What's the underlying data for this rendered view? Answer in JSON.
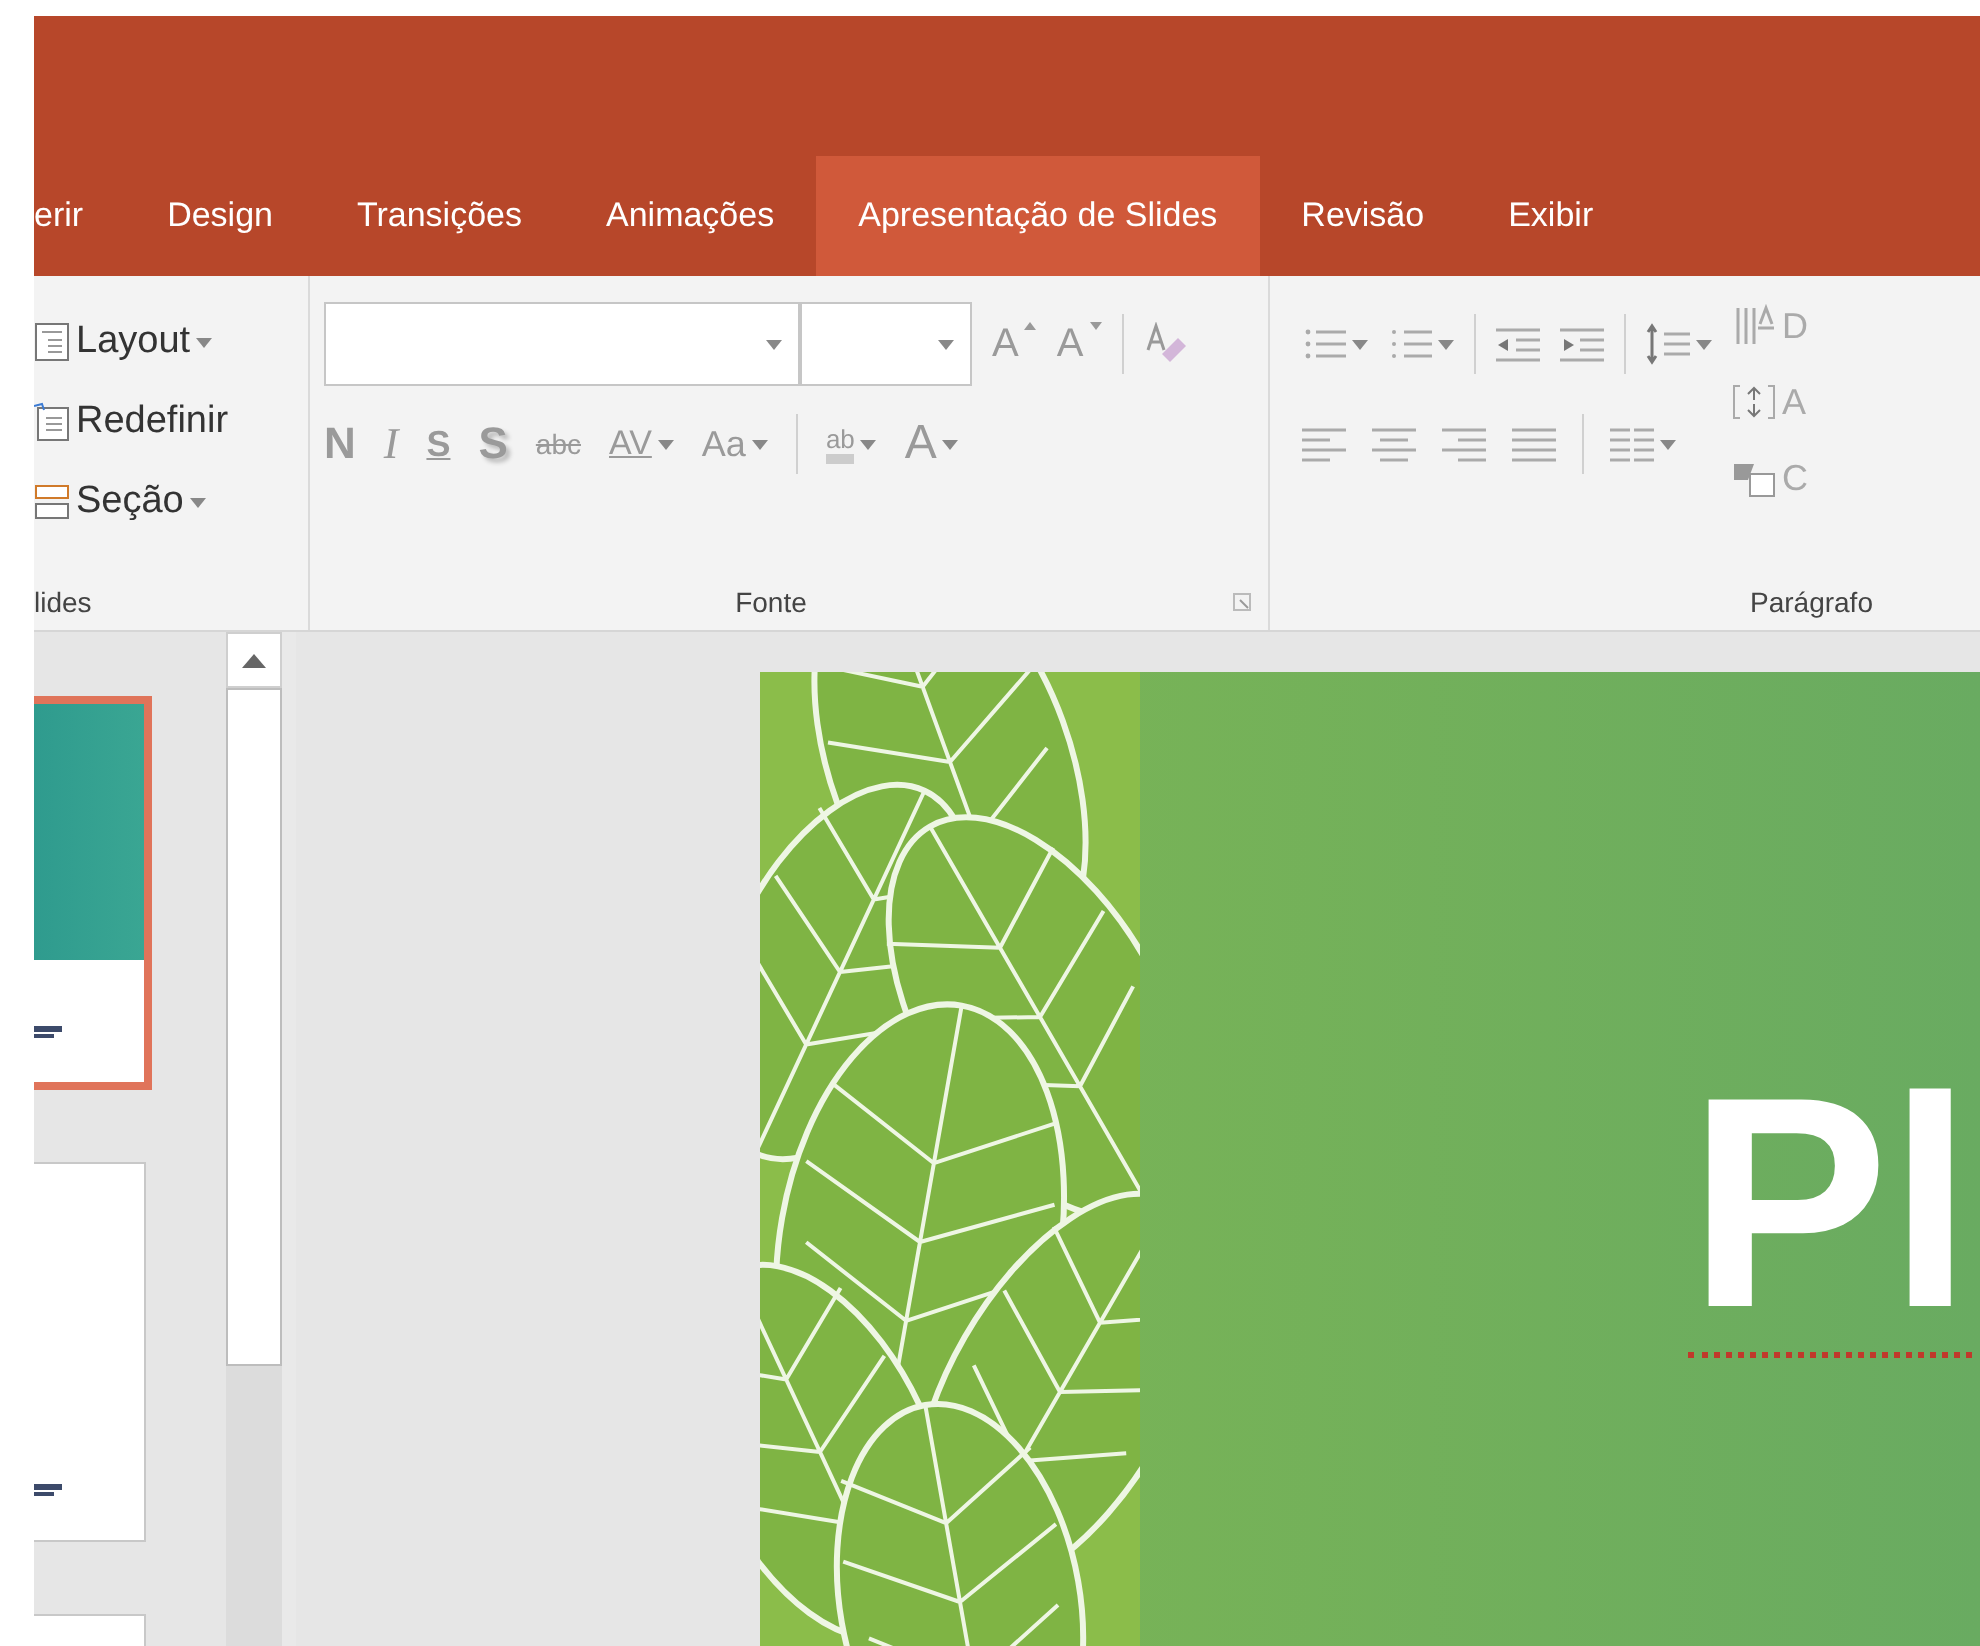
{
  "tabs": [
    {
      "label": "erir",
      "selected": false
    },
    {
      "label": "Design",
      "selected": false
    },
    {
      "label": "Transições",
      "selected": false
    },
    {
      "label": "Animações",
      "selected": false
    },
    {
      "label": "Apresentação de Slides",
      "selected": true
    },
    {
      "label": "Revisão",
      "selected": false
    },
    {
      "label": "Exibir",
      "selected": false
    }
  ],
  "slides_group": {
    "buttons": [
      {
        "label": "Layout",
        "kind": "layout",
        "dropdown": true
      },
      {
        "label": "Redefinir",
        "kind": "reset",
        "dropdown": false
      },
      {
        "label": "Seção",
        "kind": "section",
        "dropdown": true
      }
    ],
    "label": "lides"
  },
  "font_group": {
    "row1": [
      {
        "label": "A",
        "kind": "grow"
      },
      {
        "label": "A",
        "kind": "shrink"
      },
      {
        "kind": "clear"
      }
    ],
    "row2": [
      {
        "label": "N",
        "kind": "bold",
        "dropdown": false
      },
      {
        "label": "I",
        "kind": "italic",
        "dropdown": false
      },
      {
        "label": "S",
        "kind": "underline",
        "dropdown": false
      },
      {
        "label": "S",
        "kind": "shadow",
        "dropdown": false
      },
      {
        "label": "abc",
        "kind": "strike",
        "dropdown": false
      },
      {
        "label": "AV",
        "kind": "spacing",
        "dropdown": true
      },
      {
        "label": "Aa",
        "kind": "case",
        "dropdown": true
      },
      {
        "label": "ab",
        "kind": "highlight",
        "dropdown": true
      },
      {
        "label": "A",
        "kind": "color",
        "dropdown": true
      }
    ],
    "label": "Fonte"
  },
  "paragraph_group": {
    "row1": [
      {
        "kind": "bullets",
        "dropdown": true
      },
      {
        "kind": "numbering",
        "dropdown": true
      },
      {
        "kind": "outdent",
        "dropdown": false
      },
      {
        "kind": "indent",
        "dropdown": false
      },
      {
        "kind": "linespacing",
        "dropdown": true
      }
    ],
    "row2": [
      {
        "kind": "left",
        "dropdown": false
      },
      {
        "kind": "center",
        "dropdown": false
      },
      {
        "kind": "right",
        "dropdown": false
      },
      {
        "kind": "justify",
        "dropdown": false
      },
      {
        "kind": "columns",
        "dropdown": true
      }
    ],
    "side": [
      {
        "label": "D",
        "kind": "direction"
      },
      {
        "label": "A",
        "kind": "align"
      },
      {
        "label": "C",
        "kind": "convert"
      }
    ],
    "label": "Parágrafo"
  },
  "thumbnails": [
    {
      "selected": true,
      "kind": "teal"
    },
    {
      "selected": false,
      "kind": "white"
    },
    {
      "selected": false,
      "kind": "blank"
    }
  ],
  "slide": {
    "title": "Pl"
  }
}
